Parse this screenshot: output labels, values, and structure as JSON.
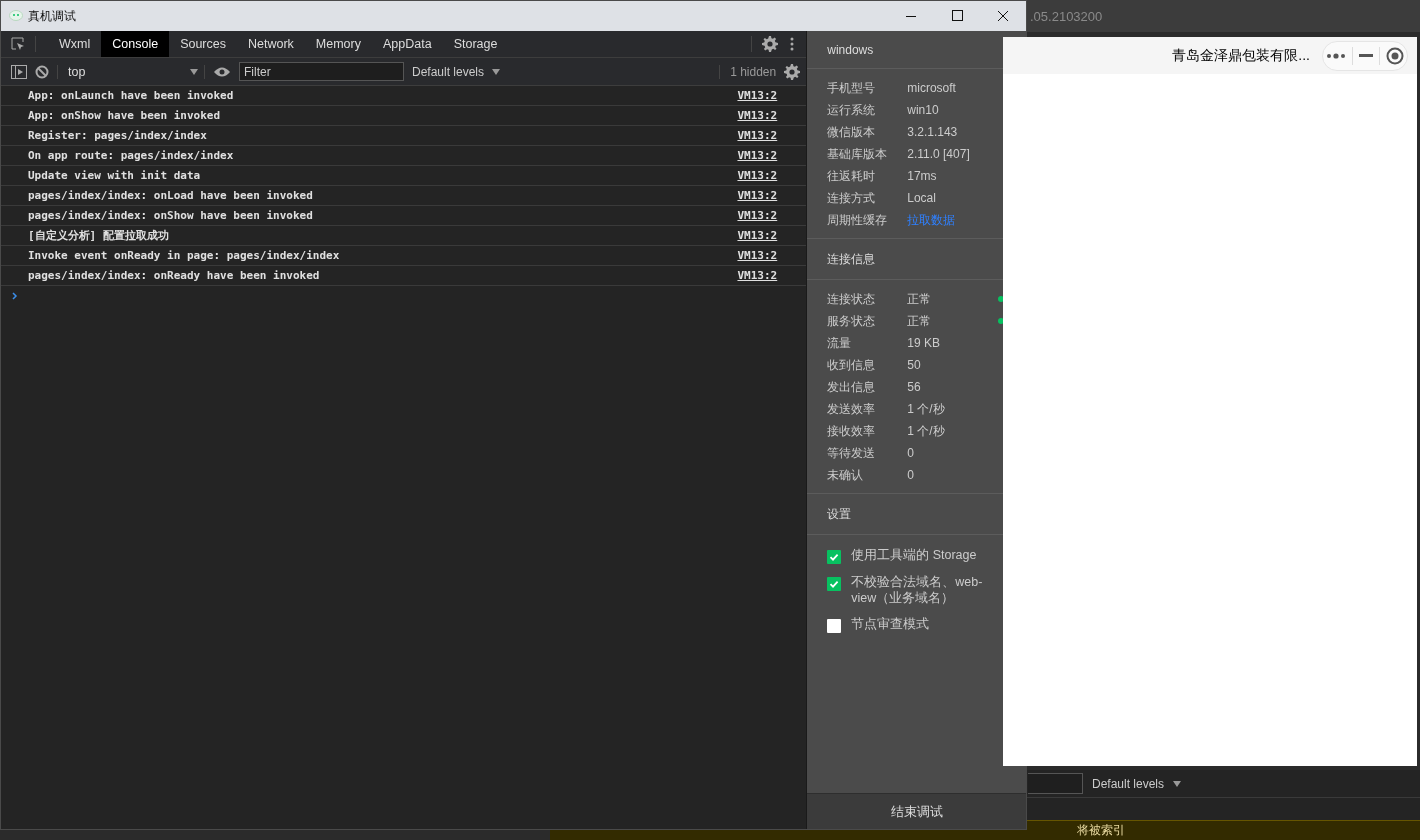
{
  "background_ide": {
    "title_fragment": ".05.2103200",
    "levels": "Default levels",
    "warning": "将被索引"
  },
  "window": {
    "title": "真机调试"
  },
  "devtools": {
    "tabs": [
      {
        "label": "Wxml",
        "selected": false
      },
      {
        "label": "Console",
        "selected": true
      },
      {
        "label": "Sources",
        "selected": false
      },
      {
        "label": "Network",
        "selected": false
      },
      {
        "label": "Memory",
        "selected": false
      },
      {
        "label": "AppData",
        "selected": false
      },
      {
        "label": "Storage",
        "selected": false
      }
    ],
    "context": "top",
    "filter_placeholder": "Filter",
    "levels": "Default levels",
    "hidden_count": "1 hidden",
    "messages": [
      {
        "text": "App: onLaunch have been invoked",
        "source": "VM13:2"
      },
      {
        "text": "App: onShow have been invoked",
        "source": "VM13:2"
      },
      {
        "text": "Register: pages/index/index",
        "source": "VM13:2"
      },
      {
        "text": "On app route: pages/index/index",
        "source": "VM13:2"
      },
      {
        "text": "Update view with init data",
        "source": "VM13:2"
      },
      {
        "text": "pages/index/index: onLoad have been invoked",
        "source": "VM13:2"
      },
      {
        "text": "pages/index/index: onShow have been invoked",
        "source": "VM13:2"
      },
      {
        "text": "[自定义分析] 配置拉取成功",
        "source": "VM13:2"
      },
      {
        "text": "Invoke event onReady in page: pages/index/index",
        "source": "VM13:2"
      },
      {
        "text": "pages/index/index: onReady have been invoked",
        "source": "VM13:2"
      }
    ]
  },
  "info_panel": {
    "title": "windows",
    "device": [
      {
        "label": "手机型号",
        "value": "microsoft",
        "kind": "text"
      },
      {
        "label": "运行系统",
        "value": "win10",
        "kind": "text"
      },
      {
        "label": "微信版本",
        "value": "3.2.1.143",
        "kind": "text"
      },
      {
        "label": "基础库版本",
        "value": "2.11.0 [407]",
        "kind": "text"
      },
      {
        "label": "往返耗时",
        "value": "17ms",
        "kind": "text"
      },
      {
        "label": "连接方式",
        "value": "Local",
        "kind": "text"
      },
      {
        "label": "周期性缓存",
        "value": "拉取数据",
        "kind": "link"
      }
    ],
    "connection_title": "连接信息",
    "connection": [
      {
        "label": "连接状态",
        "value": "正常",
        "color": "#07c160"
      },
      {
        "label": "服务状态",
        "value": "正常",
        "color": "#07c160"
      },
      {
        "label": "流量",
        "value": "19 KB"
      },
      {
        "label": "收到信息",
        "value": "50"
      },
      {
        "label": "发出信息",
        "value": "56"
      },
      {
        "label": "发送效率",
        "value": "1 个/秒"
      },
      {
        "label": "接收效率",
        "value": "1 个/秒"
      },
      {
        "label": "等待发送",
        "value": "0"
      },
      {
        "label": "未确认",
        "value": "0"
      }
    ],
    "settings_title": "设置",
    "settings": [
      {
        "label": "使用工具端的 Storage",
        "checked": true
      },
      {
        "label": "不校验合法域名、web-view（业务域名）",
        "checked": true
      },
      {
        "label": "节点审查模式",
        "checked": false
      }
    ],
    "end_button": "结束调试"
  },
  "simulator": {
    "title": "青岛金泽鼎包装有限..."
  }
}
